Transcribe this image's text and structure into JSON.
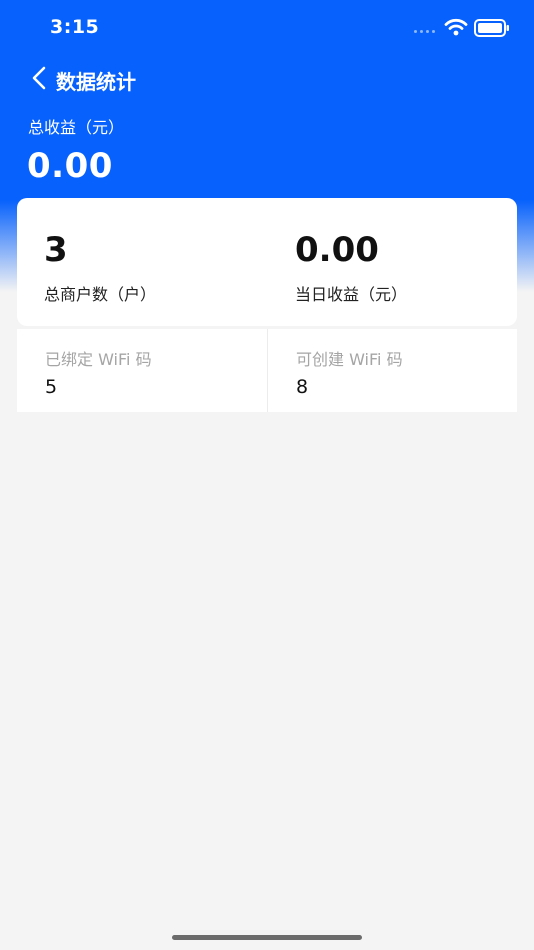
{
  "status_bar": {
    "time": "3:15"
  },
  "nav": {
    "title": "数据统计",
    "back_icon": "chevron-left-icon"
  },
  "summary": {
    "total_income_label": "总收益（元）",
    "total_income_value": "0.00"
  },
  "stats": {
    "merchants_value": "3",
    "merchants_label": "总商户数（户）",
    "today_income_value": "0.00",
    "today_income_label": "当日收益（元）"
  },
  "wifi_codes": {
    "bound_label": "已绑定 WiFi 码",
    "bound_value": "5",
    "creatable_label": "可创建 WiFi 码",
    "creatable_value": "8"
  },
  "colors": {
    "primary": "#0761fc",
    "page_background": "#f4f4f4",
    "card_background": "#ffffff",
    "muted_text": "#a5a5a5"
  }
}
